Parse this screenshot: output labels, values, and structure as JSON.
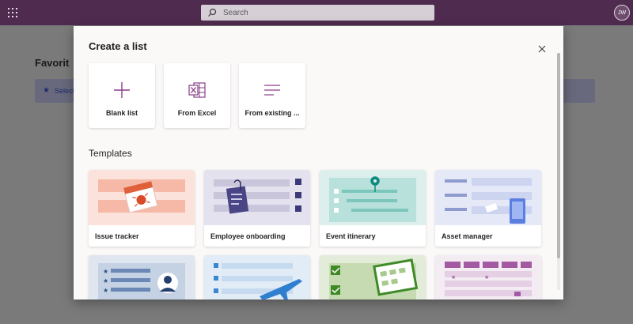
{
  "topbar": {
    "search_placeholder": "Search",
    "avatar_initials": "JW"
  },
  "background_page": {
    "title": "Favorit",
    "banner_text": "Select"
  },
  "modal": {
    "title": "Create a list",
    "create_options": [
      {
        "label": "Blank list",
        "icon": "plus-icon"
      },
      {
        "label": "From Excel",
        "icon": "excel-icon"
      },
      {
        "label": "From existing ...",
        "icon": "list-lines-icon"
      }
    ],
    "templates_heading": "Templates",
    "templates": [
      {
        "label": "Issue tracker",
        "color": "#fbe3dc"
      },
      {
        "label": "Employee onboarding",
        "color": "#e4e2ee"
      },
      {
        "label": "Event itinerary",
        "color": "#dcefec"
      },
      {
        "label": "Asset manager",
        "color": "#e5e9f7"
      },
      {
        "label": "",
        "color": "#dfe6ef"
      },
      {
        "label": "",
        "color": "#e1ecf6"
      },
      {
        "label": "",
        "color": "#e3ecd9"
      },
      {
        "label": "",
        "color": "#f3ecf3"
      }
    ]
  },
  "colors": {
    "suite_bar": "#4f2c4f",
    "accent_purple": "#8a3f8a",
    "teal": "#0e8a80"
  }
}
